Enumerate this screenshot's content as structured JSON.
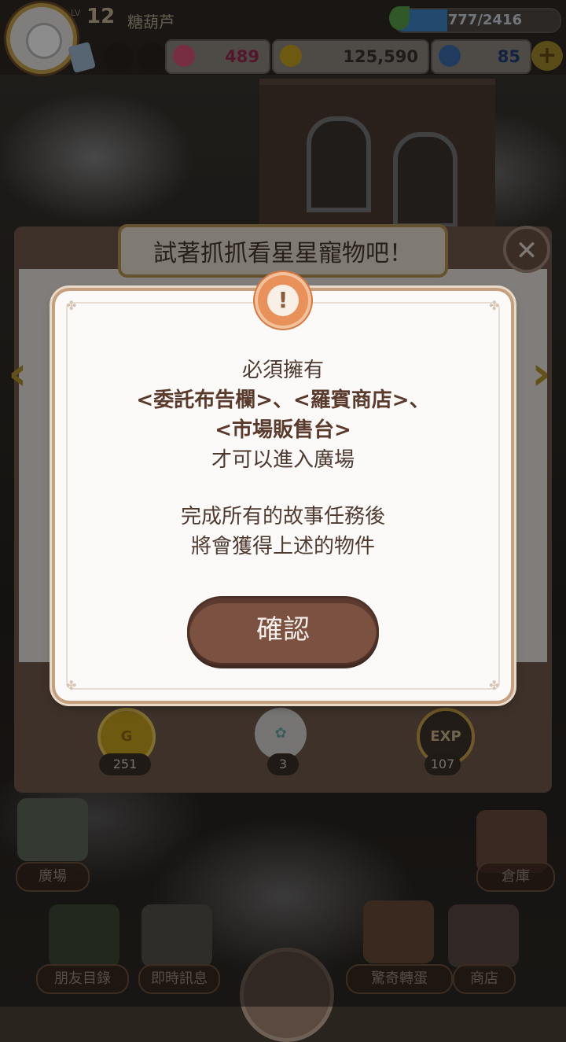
{
  "player": {
    "level_prefix": "LV",
    "level": "12",
    "name": "糖葫芦",
    "exp_text": "777/2416",
    "exp_progress": 0.32
  },
  "resources": {
    "hearts": "489",
    "coins": "125,590",
    "crystals": "85"
  },
  "panel": {
    "title": "試著抓抓看星星寵物吧！",
    "close_symbol": "✕",
    "rewards": [
      {
        "icon": "coin-icon",
        "count": "251"
      },
      {
        "icon": "cookie-bowl-icon",
        "count": "3"
      },
      {
        "icon": "exp-icon",
        "label": "EXP",
        "count": "107"
      }
    ]
  },
  "modal": {
    "line1": "必須擁有",
    "line2": "<委託布告欄>、<羅賓商店>、",
    "line3": "<市場販售台>",
    "line4": "才可以進入廣場",
    "line5": "完成所有的故事任務後",
    "line6": "將會獲得上述的物件",
    "confirm": "確認"
  },
  "nav": {
    "plaza": "廣場",
    "warehouse": "倉庫",
    "friends": "朋友目錄",
    "messages": "即時訊息",
    "gacha": "驚奇轉蛋",
    "shop": "商店"
  },
  "colors": {
    "accent_brown": "#7b5142",
    "gold": "#b59652",
    "exp_blue": "#3f86c9"
  }
}
